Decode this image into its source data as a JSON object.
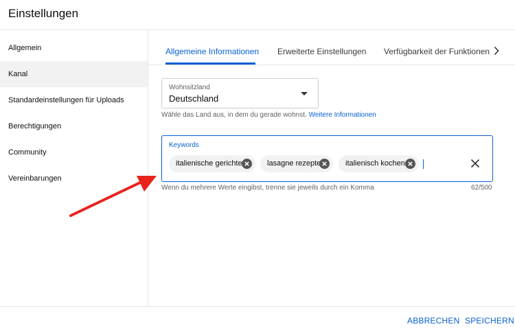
{
  "header": {
    "title": "Einstellungen"
  },
  "sidebar": {
    "items": [
      {
        "label": "Allgemein"
      },
      {
        "label": "Kanal"
      },
      {
        "label": "Standardeinstellungen für Uploads"
      },
      {
        "label": "Berechtigungen"
      },
      {
        "label": "Community"
      },
      {
        "label": "Vereinbarungen"
      }
    ],
    "active_item": "Kanal"
  },
  "tabs": {
    "items": [
      {
        "label": "Allgemeine Informationen"
      },
      {
        "label": "Erweiterte Einstellungen"
      },
      {
        "label": "Verfügbarkeit der Funktionen"
      }
    ],
    "active_tab": "Allgemeine Informationen",
    "next_icon": "chevron-right-icon"
  },
  "country": {
    "label": "Wohnsitzland",
    "value": "Deutschland",
    "help_text": "Wähle das Land aus, in dem du gerade wohnst.",
    "help_link": "Weitere Informationen"
  },
  "keywords": {
    "label": "Keywords",
    "chips": [
      {
        "text": "italienische gerichte"
      },
      {
        "text": "lasagne rezepte"
      },
      {
        "text": "italienisch kochen"
      }
    ],
    "help_text": "Wenn du mehrere Werte eingibst, trenne sie jeweils durch ein Komma",
    "counter": "62/500"
  },
  "footer": {
    "cancel_label": "ABBRECHEN",
    "save_label": "SPEICHERN"
  },
  "colors": {
    "accent": "#065fd4",
    "annotation_arrow": "#e8231b"
  }
}
